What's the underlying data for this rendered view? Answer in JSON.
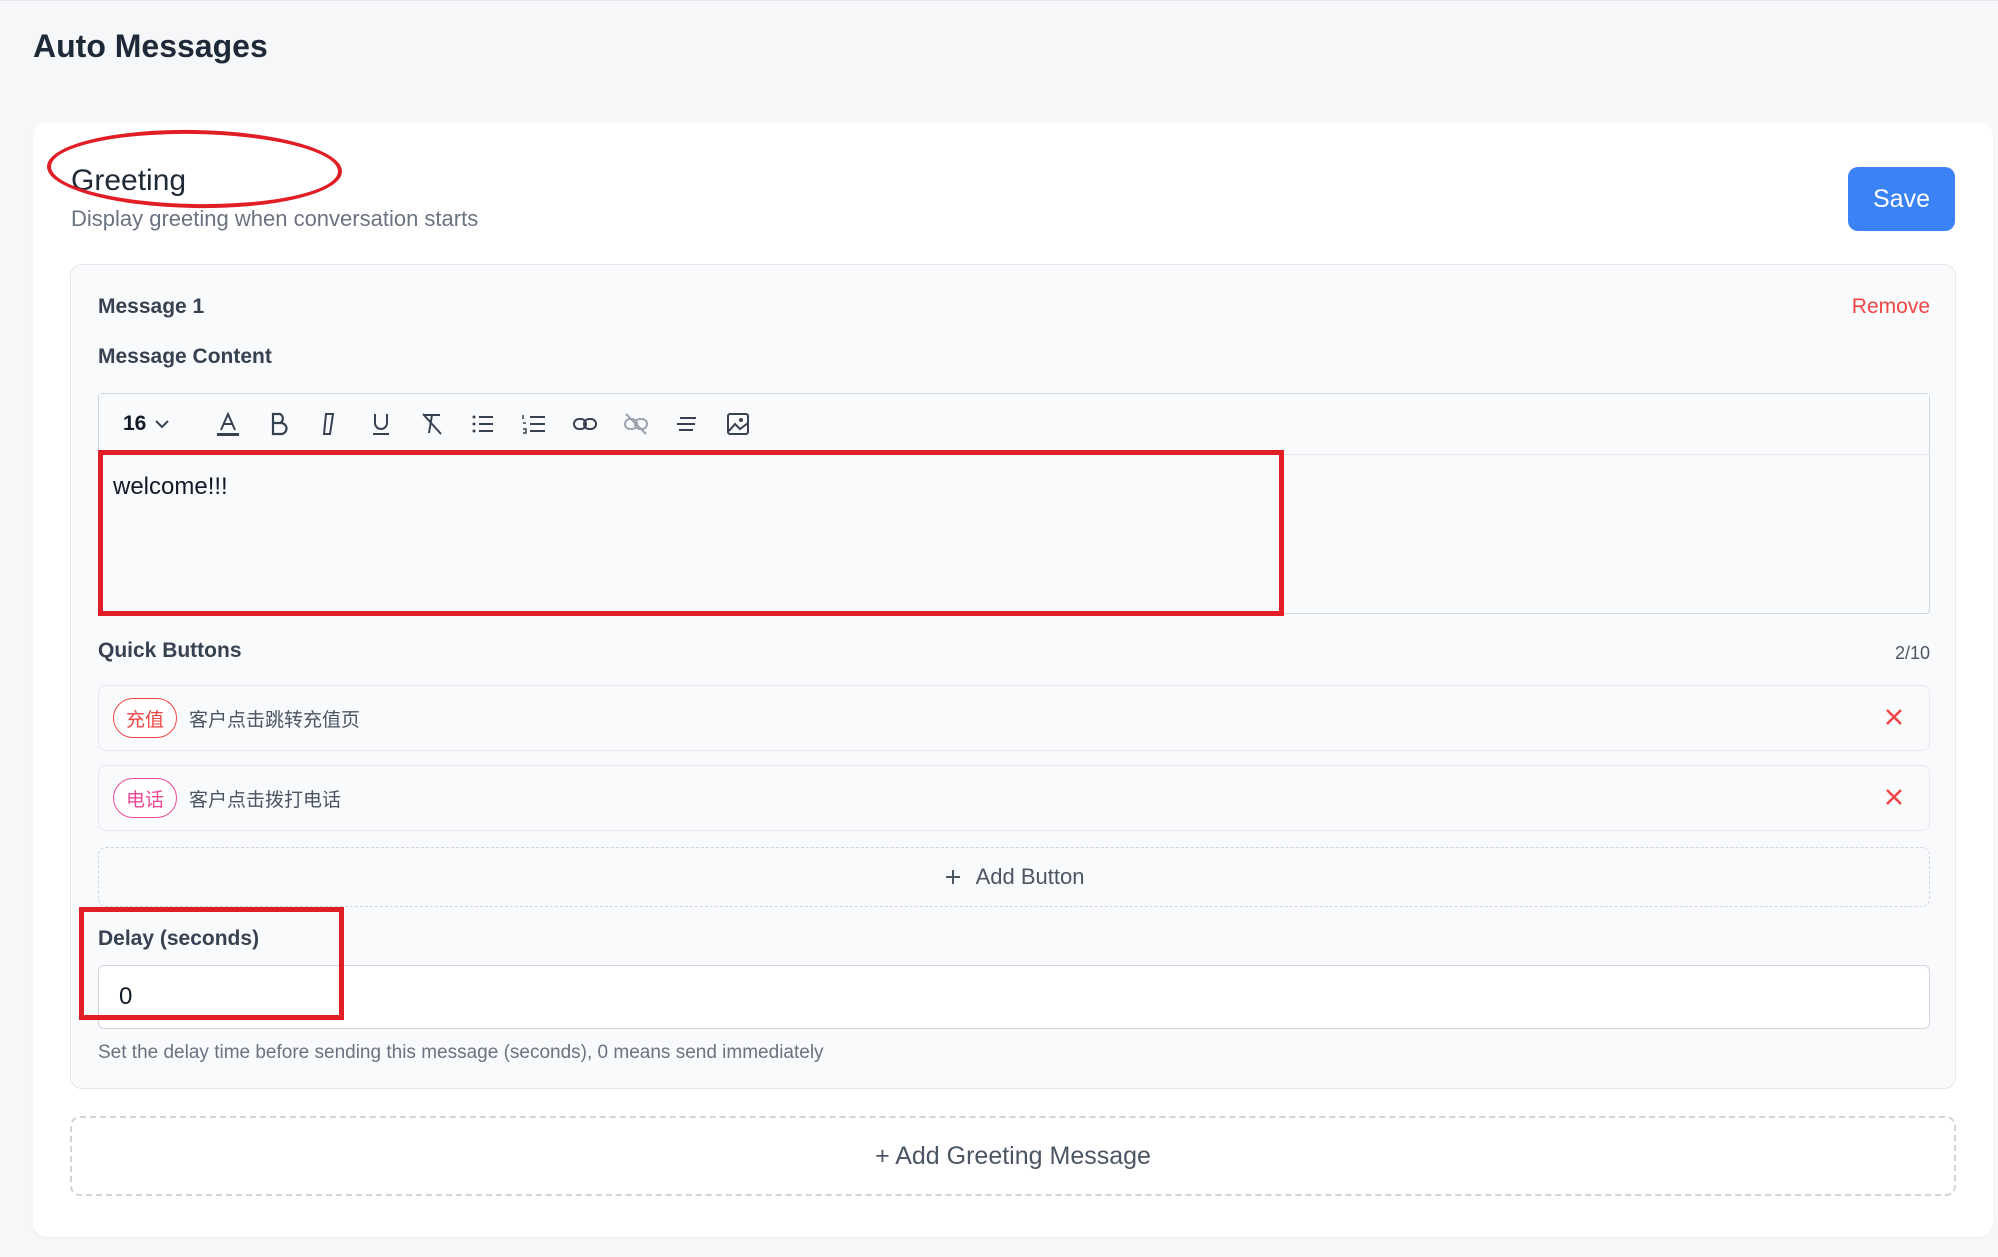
{
  "page": {
    "title": "Auto Messages"
  },
  "section": {
    "title": "Greeting",
    "subtitle": "Display greeting when conversation starts",
    "save_label": "Save"
  },
  "message": {
    "label": "Message 1",
    "remove_label": "Remove",
    "content_label": "Message Content",
    "toolbar": {
      "font_size": "16",
      "icons": [
        "font-color-icon",
        "bold-icon",
        "italic-icon",
        "underline-icon",
        "clear-format-icon",
        "bullet-list-icon",
        "numbered-list-icon",
        "link-icon",
        "unlink-icon",
        "align-icon",
        "image-icon"
      ]
    },
    "content": "welcome!!!",
    "quick_buttons": {
      "label": "Quick Buttons",
      "count": "2/10",
      "items": [
        {
          "tag": "充值",
          "description": "客户点击跳转充值页",
          "color": "#ef4444"
        },
        {
          "tag": "电话",
          "description": "客户点击拨打电话",
          "color": "#ec4899"
        }
      ],
      "add_label": "Add Button"
    },
    "delay": {
      "label": "Delay (seconds)",
      "value": "0",
      "hint": "Set the delay time before sending this message (seconds), 0 means send immediately"
    }
  },
  "add_greeting_label": "+ Add Greeting Message",
  "colors": {
    "accent": "#3b82f6",
    "danger": "#ef4444",
    "annotation": "#e11d25"
  }
}
